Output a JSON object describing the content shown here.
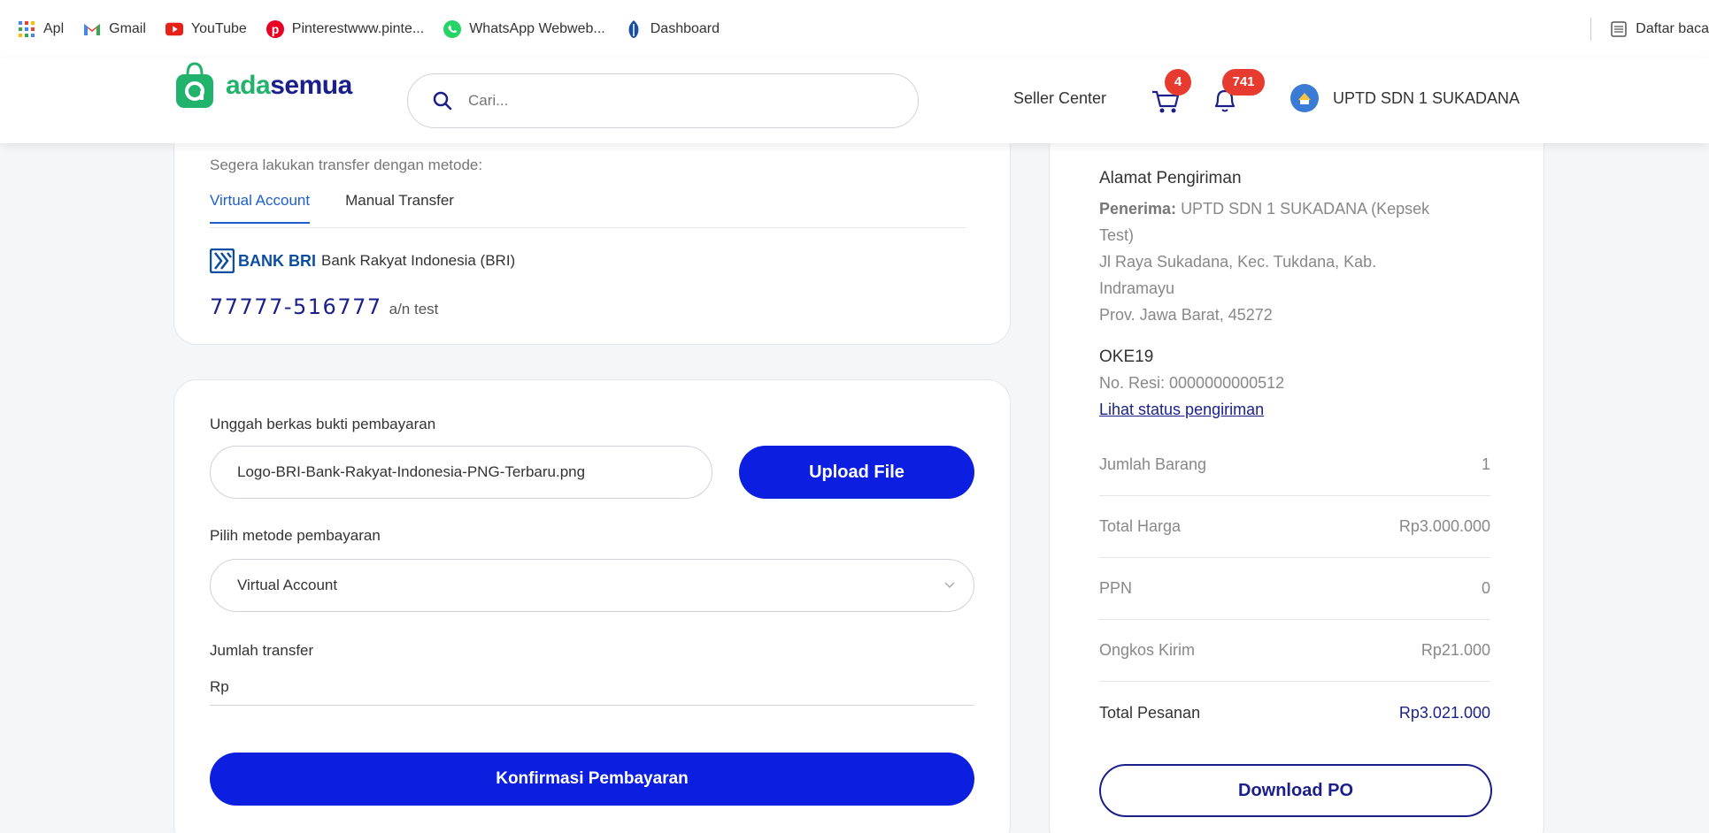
{
  "bookmarks": {
    "items": [
      {
        "label": "Apl",
        "icon": "apps-grid-icon"
      },
      {
        "label": "Gmail",
        "icon": "gmail-icon"
      },
      {
        "label": "YouTube",
        "icon": "youtube-icon"
      },
      {
        "label": "Pinterestwww.pinte...",
        "icon": "pinterest-icon"
      },
      {
        "label": "WhatsApp Webweb...",
        "icon": "whatsapp-icon"
      },
      {
        "label": "Dashboard",
        "icon": "dashboard-icon"
      }
    ],
    "reading_list": "Daftar baca"
  },
  "header": {
    "logo_part1": "ada",
    "logo_part2": "semua",
    "search_placeholder": "Cari...",
    "seller_center": "Seller Center",
    "cart_count": "4",
    "notif_count": "741",
    "user_name": "UPTD SDN 1 SUKADANA"
  },
  "payment": {
    "instruction": "Segera lakukan transfer dengan metode:",
    "tabs": [
      "Virtual Account",
      "Manual Transfer"
    ],
    "bank_logo_text": "BANK BRI",
    "bank_name": "Bank Rakyat Indonesia (BRI)",
    "account_number": "77777-516777",
    "account_holder": "a/n test"
  },
  "upload": {
    "title": "Unggah berkas bukti pembayaran",
    "filename": "Logo-BRI-Bank-Rakyat-Indonesia-PNG-Terbaru.png",
    "upload_button": "Upload File",
    "method_label": "Pilih metode pembayaran",
    "method_value": "Virtual Account",
    "amount_label": "Jumlah transfer",
    "amount_prefix": "Rp",
    "confirm_button": "Konfirmasi Pembayaran"
  },
  "summary": {
    "address_title": "Alamat Pengiriman",
    "recipient_label": "Penerima:",
    "recipient_line1": "UPTD SDN 1 SUKADANA (Kepsek",
    "recipient_line2": "Test)",
    "address_line1": "Jl Raya Sukadana, Kec. Tukdana, Kab.",
    "address_line2": "Indramayu",
    "address_line3": "Prov. Jawa Barat, 45272",
    "courier": "OKE19",
    "resi": "No. Resi: 0000000000512",
    "tracking_link": "Lihat status pengiriman",
    "rows": [
      {
        "label": "Jumlah Barang",
        "value": "1"
      },
      {
        "label": "Total Harga",
        "value": "Rp3.000.000"
      },
      {
        "label": "PPN",
        "value": "0"
      },
      {
        "label": "Ongkos Kirim",
        "value": "Rp21.000"
      }
    ],
    "total_label": "Total Pesanan",
    "total_value": "Rp3.021.000",
    "download_button": "Download PO"
  },
  "colors": {
    "primary": "#0c1ee0",
    "brand_green": "#21b36b",
    "brand_navy": "#1a1f8a",
    "badge_red": "#e63b2e",
    "link_blue": "#1e5fcf"
  }
}
